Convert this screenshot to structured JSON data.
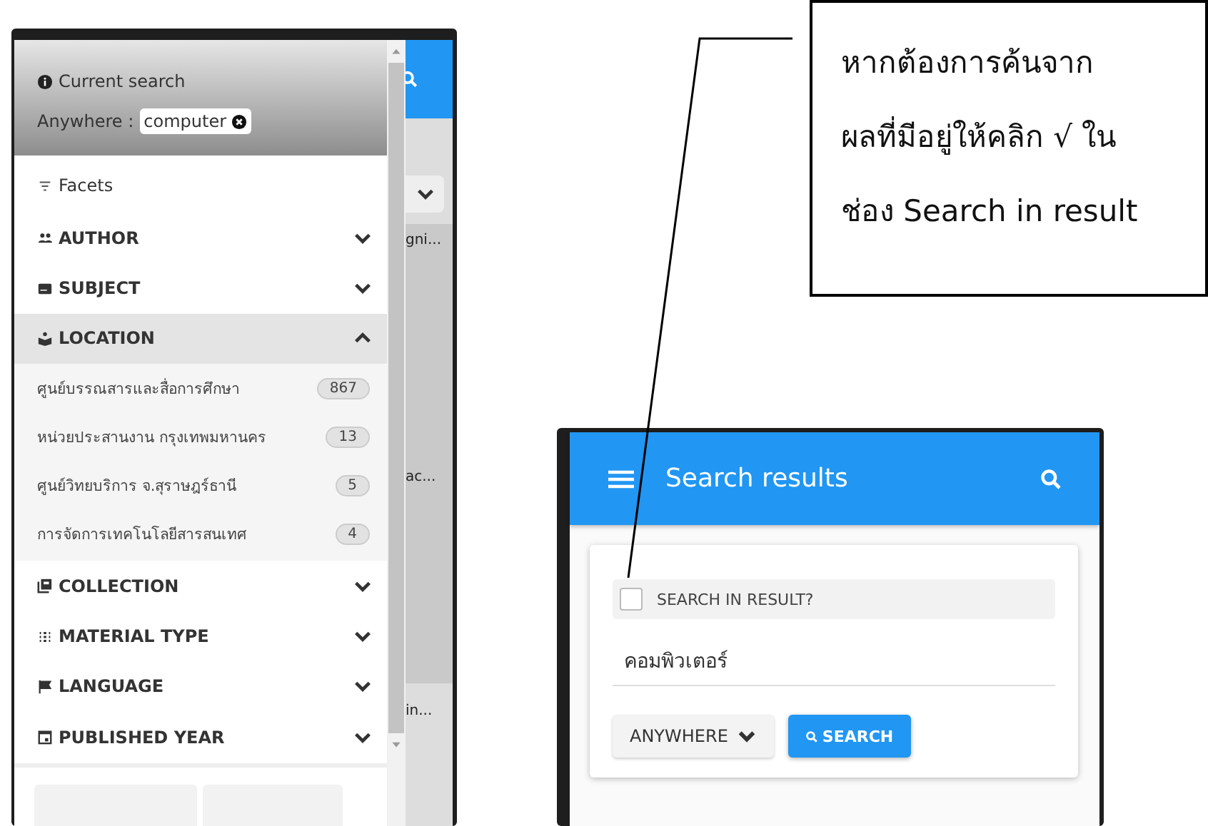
{
  "callout": {
    "lines": [
      "หากต้องการค้นจาก",
      "ผลที่มีอยู่ให้คลิก √ ใน",
      "ช่อง Search in result"
    ]
  },
  "left_screen": {
    "current_search": {
      "title": "Current search",
      "field": "Anywhere :",
      "term": "computer"
    },
    "facets_title": "Facets",
    "facets": [
      {
        "label": "AUTHOR",
        "kind": "people",
        "expanded": false
      },
      {
        "label": "SUBJECT",
        "kind": "card",
        "expanded": false
      },
      {
        "label": "LOCATION",
        "kind": "pin",
        "expanded": true,
        "items": [
          {
            "label": "ศูนย์บรรณสารและสื่อการศึกษา",
            "count": "867"
          },
          {
            "label": "หน่วยประสานงาน กรุงเทพมหานคร",
            "count": "13"
          },
          {
            "label": "ศูนย์วิทยบริการ จ.สุราษฎร์ธานี",
            "count": "5"
          },
          {
            "label": "การจัดการเทคโนโลยีสารสนเทศ",
            "count": "4"
          }
        ]
      },
      {
        "label": "COLLECTION",
        "kind": "library",
        "expanded": false
      },
      {
        "label": "MATERIAL TYPE",
        "kind": "grid",
        "expanded": false
      },
      {
        "label": "LANGUAGE",
        "kind": "flag",
        "expanded": false
      },
      {
        "label": "PUBLISHED YEAR",
        "kind": "calendar",
        "expanded": false
      }
    ],
    "background_fragments": [
      "gni...",
      "ac...",
      "in..."
    ]
  },
  "right_screen": {
    "title": "Search results",
    "search_in_result": {
      "label": "SEARCH IN RESULT?",
      "checked": false
    },
    "query": "คอมพิวเตอร์",
    "scope": "ANYWHERE",
    "search_button": "SEARCH"
  }
}
